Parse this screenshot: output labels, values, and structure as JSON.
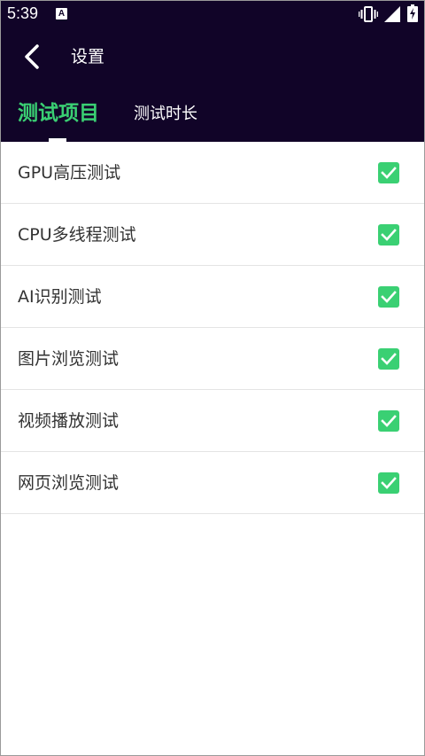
{
  "status_bar": {
    "time": "5:39",
    "notification_icon": "a-notification-icon",
    "icons": [
      "vibrate-icon",
      "signal-icon",
      "battery-charging-icon"
    ]
  },
  "toolbar": {
    "back_icon": "chevron-left-icon",
    "title": "设置"
  },
  "tabs": [
    {
      "label": "测试项目",
      "active": true
    },
    {
      "label": "测试时长",
      "active": false
    }
  ],
  "items": [
    {
      "label": "GPU高压测试",
      "checked": true
    },
    {
      "label": "CPU多线程测试",
      "checked": true
    },
    {
      "label": "AI识别测试",
      "checked": true
    },
    {
      "label": "图片浏览测试",
      "checked": true
    },
    {
      "label": "视频播放测试",
      "checked": true
    },
    {
      "label": "网页浏览测试",
      "checked": true
    }
  ],
  "colors": {
    "header_bg": "#110428",
    "accent": "#3ad073",
    "text": "#333333",
    "divider": "#e4e4e4"
  }
}
